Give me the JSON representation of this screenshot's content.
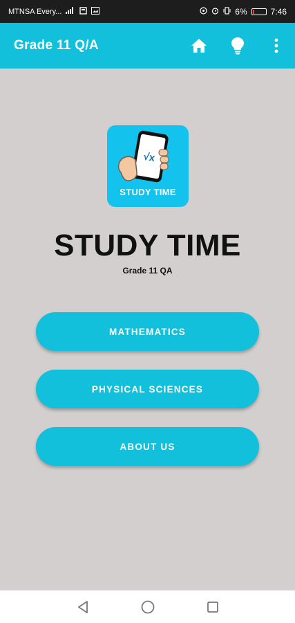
{
  "status_bar": {
    "carrier": "MTNSA Every...",
    "battery_percent": "6%",
    "time": "7:46"
  },
  "app_bar": {
    "title": "Grade 11 Q/A",
    "icons": [
      "home-icon",
      "lightbulb-icon",
      "more-vert-icon"
    ],
    "color": "#13c0dc"
  },
  "logo": {
    "caption": "STUDY TIME",
    "symbol": "√x"
  },
  "main": {
    "title": "STUDY TIME",
    "subtitle": "Grade 11 QA",
    "buttons": [
      {
        "label": "MATHEMATICS"
      },
      {
        "label": "PHYSICAL SCIENCES"
      },
      {
        "label": "ABOUT US"
      }
    ]
  },
  "nav_bar": {
    "icons": [
      "back-icon",
      "home-circle-icon",
      "recents-icon"
    ]
  }
}
